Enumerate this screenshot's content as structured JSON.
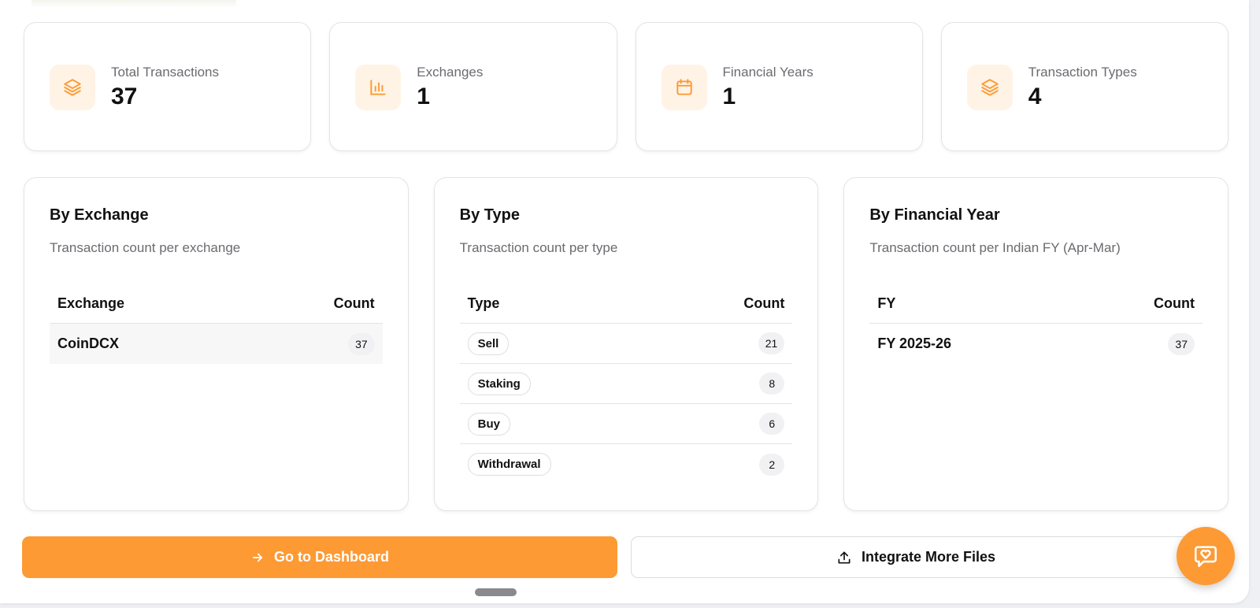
{
  "colors": {
    "accent": "#fd9a34",
    "icon_bg": "#fff3e6",
    "muted_text": "#6b6b70"
  },
  "stats": [
    {
      "label": "Total Transactions",
      "value": "37",
      "icon": "layers-icon"
    },
    {
      "label": "Exchanges",
      "value": "1",
      "icon": "bar-chart-icon"
    },
    {
      "label": "Financial Years",
      "value": "1",
      "icon": "calendar-icon"
    },
    {
      "label": "Transaction Types",
      "value": "4",
      "icon": "layers-icon"
    }
  ],
  "by_exchange": {
    "title": "By Exchange",
    "description": "Transaction count per exchange",
    "col_name": "Exchange",
    "col_count": "Count",
    "rows": [
      {
        "name": "CoinDCX",
        "count": "37"
      }
    ]
  },
  "by_type": {
    "title": "By Type",
    "description": "Transaction count per type",
    "col_name": "Type",
    "col_count": "Count",
    "rows": [
      {
        "name": "Sell",
        "count": "21"
      },
      {
        "name": "Staking",
        "count": "8"
      },
      {
        "name": "Buy",
        "count": "6"
      },
      {
        "name": "Withdrawal",
        "count": "2"
      }
    ]
  },
  "by_fy": {
    "title": "By Financial Year",
    "description": "Transaction count per Indian FY (Apr-Mar)",
    "col_name": "FY",
    "col_count": "Count",
    "rows": [
      {
        "name": "FY 2025-26",
        "count": "37"
      }
    ]
  },
  "actions": {
    "dashboard_label": "Go to Dashboard",
    "dashboard_icon": "arrow-right-icon",
    "integrate_label": "Integrate More Files",
    "integrate_icon": "upload-icon",
    "chat_icon": "chat-heart-icon"
  }
}
